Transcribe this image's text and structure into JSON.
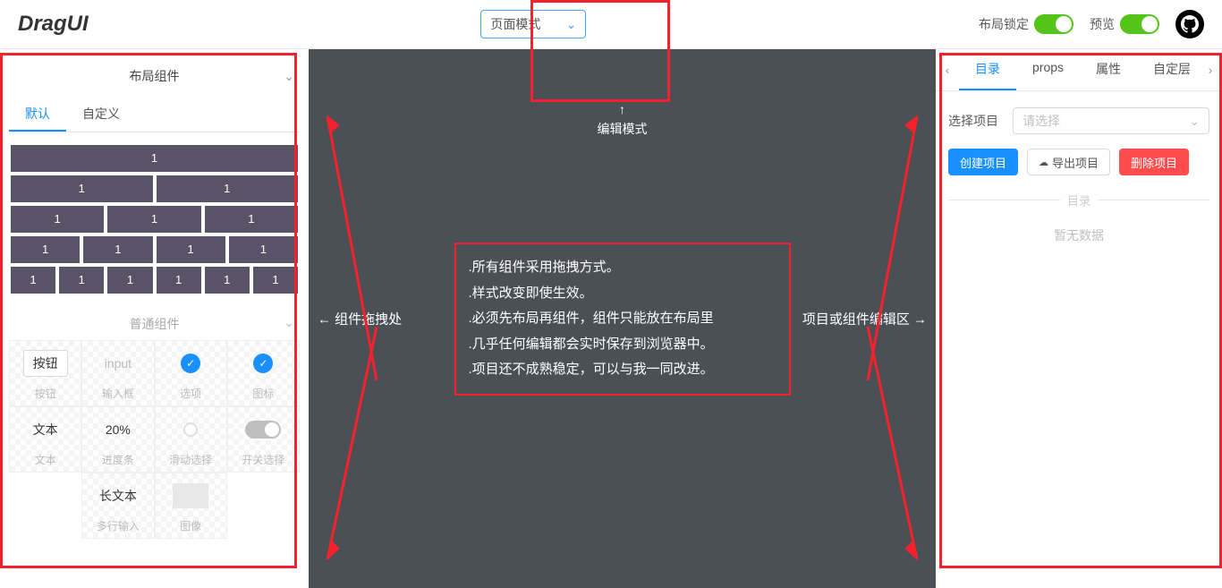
{
  "header": {
    "logo": "DragUI",
    "mode_select": "页面模式",
    "lock_label": "布局锁定",
    "preview_label": "预览"
  },
  "left": {
    "layout_title": "布局组件",
    "tabs": {
      "default": "默认",
      "custom": "自定义"
    },
    "cell_label": "1",
    "normal_title": "普通组件",
    "components": {
      "button": {
        "preview": "按钮",
        "label": "按钮"
      },
      "input": {
        "preview": "input",
        "label": "输入框"
      },
      "checkbox": {
        "label": "选项"
      },
      "icon": {
        "label": "图标"
      },
      "text": {
        "preview": "文本",
        "label": "文本"
      },
      "progress": {
        "preview": "20%",
        "label": "进度条"
      },
      "slider": {
        "label": "滑动选择"
      },
      "switch": {
        "label": "开关选择"
      },
      "textarea": {
        "preview": "长文本",
        "label": "多行输入"
      },
      "image": {
        "label": "图像"
      }
    }
  },
  "canvas": {
    "edit_arrow": "↑",
    "edit_mode": "编辑模式",
    "drag_hint_left": "← 组件拖拽处",
    "drag_hint_right": "项目或组件编辑区 →",
    "tips": [
      ".所有组件采用拖拽方式。",
      ".样式改变即使生效。",
      ".必须先布局再组件，组件只能放在布局里",
      ".几乎任何编辑都会实时保存到浏览器中。",
      ".项目还不成熟稳定，可以与我一同改进。"
    ]
  },
  "right": {
    "tabs": {
      "dir": "目录",
      "props": "props",
      "attr": "属性",
      "custom": "自定层"
    },
    "select_label": "选择项目",
    "select_placeholder": "请选择",
    "btn_create": "创建项目",
    "btn_export": "导出项目",
    "btn_delete": "删除项目",
    "divider": "目录",
    "nodata": "暂无数据"
  }
}
